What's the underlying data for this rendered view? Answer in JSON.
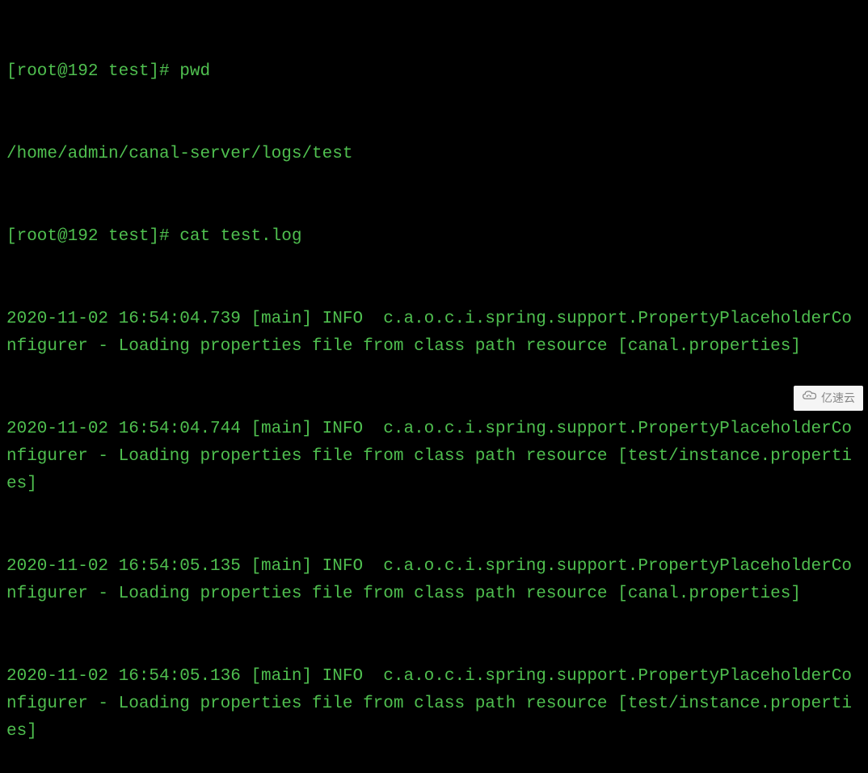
{
  "terminal": {
    "lines": [
      "[root@192 test]# pwd",
      "/home/admin/canal-server/logs/test",
      "[root@192 test]# cat test.log",
      "2020-11-02 16:54:04.739 [main] INFO  c.a.o.c.i.spring.support.PropertyPlaceholderConfigurer - Loading properties file from class path resource [canal.properties]",
      "2020-11-02 16:54:04.744 [main] INFO  c.a.o.c.i.spring.support.PropertyPlaceholderConfigurer - Loading properties file from class path resource [test/instance.properties]",
      "2020-11-02 16:54:05.135 [main] INFO  c.a.o.c.i.spring.support.PropertyPlaceholderConfigurer - Loading properties file from class path resource [canal.properties]",
      "2020-11-02 16:54:05.136 [main] INFO  c.a.o.c.i.spring.support.PropertyPlaceholderConfigurer - Loading properties file from class path resource [test/instance.properties]"
    ]
  },
  "watermark": {
    "label": "亿速云"
  }
}
